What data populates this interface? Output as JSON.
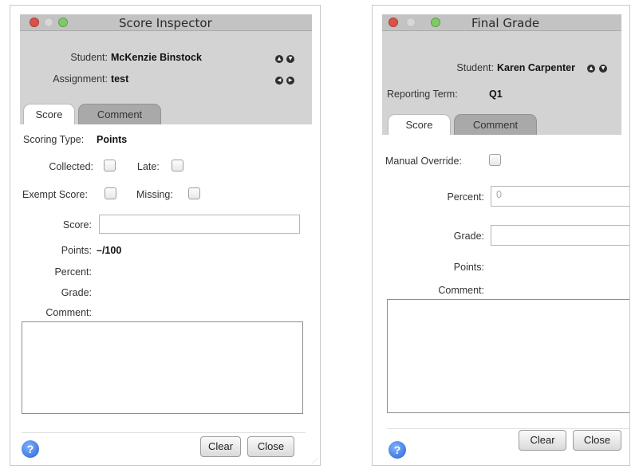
{
  "score_inspector": {
    "title": "Score Inspector",
    "student_label": "Student:",
    "student_name": "McKenzie Binstock",
    "assignment_label": "Assignment:",
    "assignment_name": "test",
    "tabs": [
      {
        "label": "Score",
        "active": true
      },
      {
        "label": "Comment",
        "active": false
      }
    ],
    "scoring_type_label": "Scoring Type:",
    "scoring_type_value": "Points",
    "collected_label": "Collected:",
    "late_label": "Late:",
    "exempt_label": "Exempt Score:",
    "missing_label": "Missing:",
    "score_label": "Score:",
    "score_value": "",
    "points_label": "Points:",
    "points_value": "–/100",
    "percent_label": "Percent:",
    "grade_label": "Grade:",
    "comment_label": "Comment:",
    "comment_value": "",
    "clear_label": "Clear",
    "close_label": "Close"
  },
  "final_grade": {
    "title": "Final Grade",
    "student_label": "Student:",
    "student_name": "Karen Carpenter",
    "term_label": "Reporting Term:",
    "term_value": "Q1",
    "tabs": [
      {
        "label": "Score",
        "active": true
      },
      {
        "label": "Comment",
        "active": false
      }
    ],
    "override_label": "Manual Override:",
    "percent_label": "Percent:",
    "percent_value": "0",
    "grade_label": "Grade:",
    "grade_value": "",
    "points_label": "Points:",
    "comment_label": "Comment:",
    "comment_value": "",
    "clear_label": "Clear",
    "close_label": "Close"
  },
  "icons": {
    "help": "?",
    "up": "▲",
    "down": "▼",
    "left": "◀",
    "right": "▶"
  },
  "colors": {
    "title_bar": "#c3c3c3",
    "header_bg": "#d3d3d3",
    "close_light": "#d9534a",
    "zoom_light": "#7fc96a",
    "help_blue": "#2a62d4"
  }
}
